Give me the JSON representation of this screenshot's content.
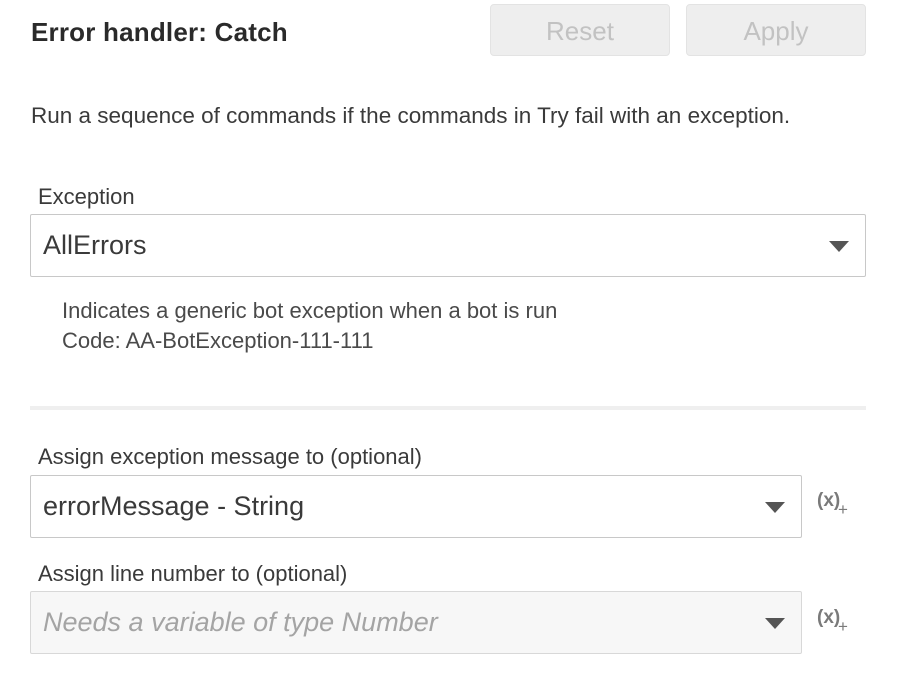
{
  "header": {
    "title": "Error handler: Catch",
    "reset_label": "Reset",
    "apply_label": "Apply"
  },
  "description": "Run a sequence of commands if the commands in Try fail with an exception.",
  "exception": {
    "label": "Exception",
    "value": "AllErrors",
    "info_line_1": "Indicates a generic bot exception when a bot is run",
    "info_line_2": "Code: AA-BotException-111-111"
  },
  "assign_message": {
    "label": "Assign exception message to (optional)",
    "value": "errorMessage - String",
    "variable_icon_x": "(x)",
    "variable_icon_plus": "+"
  },
  "assign_line": {
    "label": "Assign line number to (optional)",
    "placeholder": "Needs a variable of type Number",
    "variable_icon_x": "(x)",
    "variable_icon_plus": "+"
  },
  "colors": {
    "button_disabled_bg": "#eeeeee",
    "button_disabled_text": "#c2c2c2",
    "border": "#c8c8c8",
    "placeholder_text": "#a4a4a4"
  },
  "icons": {
    "dropdown": "caret-down-icon",
    "insert_variable": "insert-variable-icon"
  }
}
